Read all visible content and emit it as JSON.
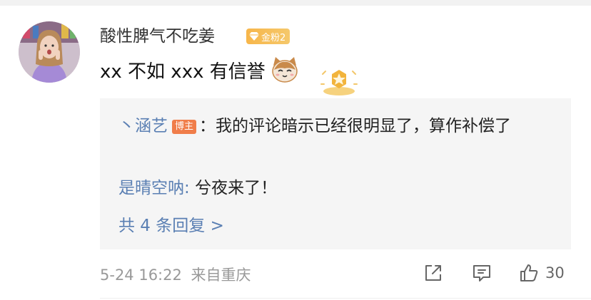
{
  "comment": {
    "username": "酸性脾气不吃姜",
    "fan_badge": "金粉2",
    "text": "xx 不如 xxx 有信誉",
    "emoji_icon": "cat-emoji-icon",
    "reward_icon": "reward-star-icon"
  },
  "replies": [
    {
      "prefix": "丶",
      "author": "涵艺",
      "badge": "博主",
      "separator": "：",
      "text": "我的评论暗示已经很明显了，算作补偿了"
    },
    {
      "author": "是晴空呐",
      "separator": ": ",
      "text": "兮夜来了！"
    }
  ],
  "more_replies_label": "共 4 条回复 >",
  "meta": {
    "timestamp": "5-24 16:22",
    "location": "来自重庆"
  },
  "actions": {
    "share_icon": "share-icon",
    "comment_icon": "comment-icon",
    "like_icon": "thumbs-up-icon",
    "like_count": "30"
  },
  "colors": {
    "link_blue": "#5a7fb3",
    "reply_bg": "#f5f5f5",
    "fan_badge": "#f7b64a",
    "host_badge": "#f07d4a"
  }
}
